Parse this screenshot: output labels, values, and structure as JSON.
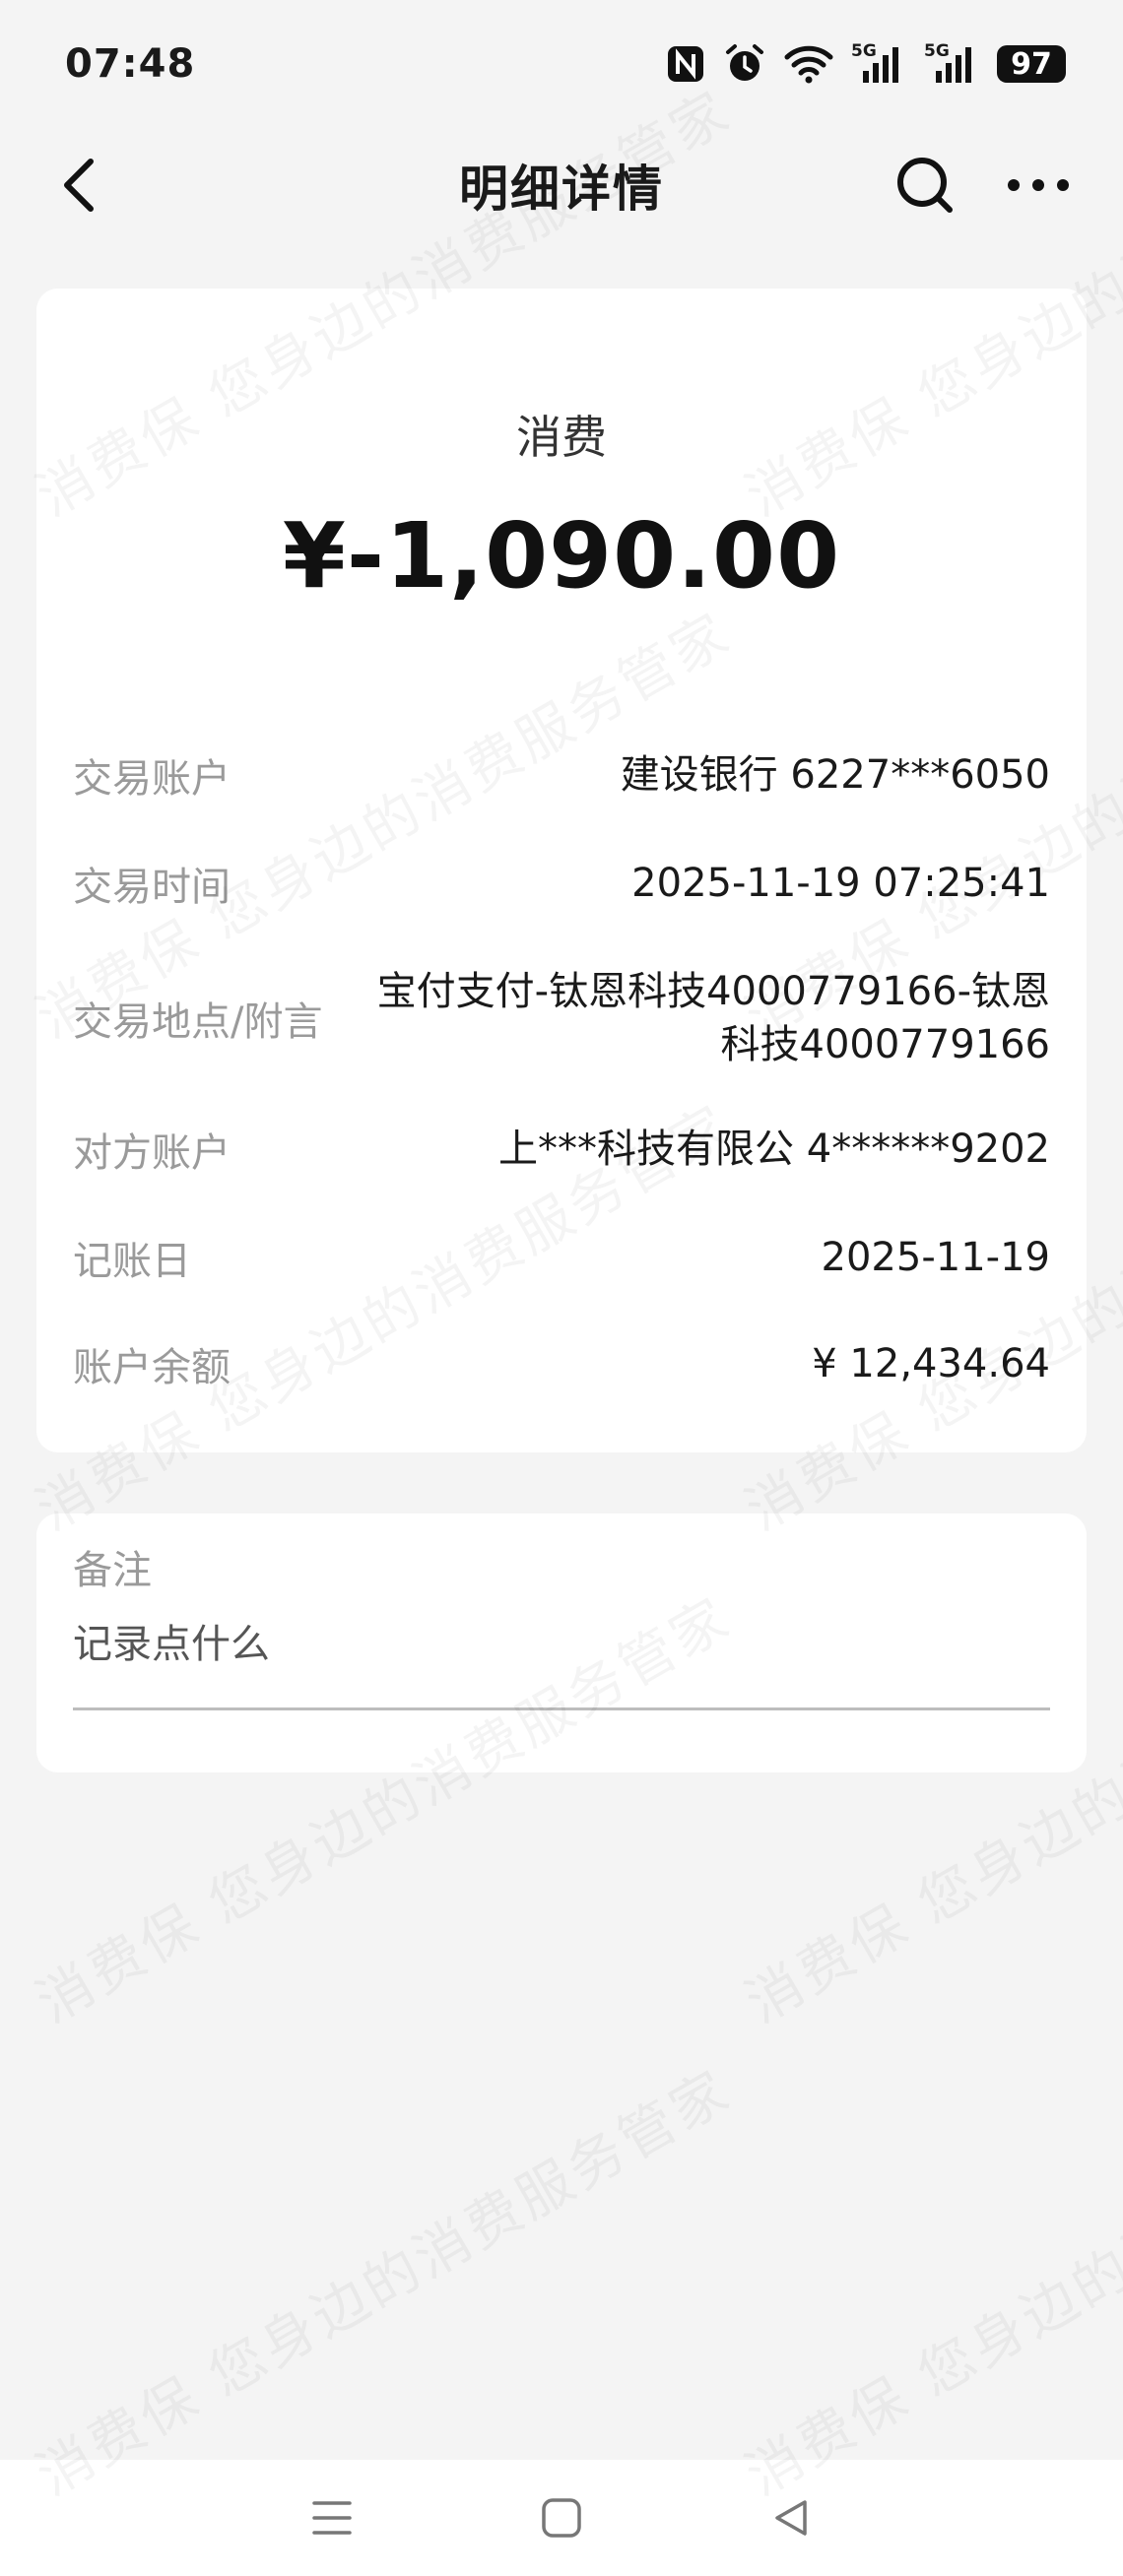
{
  "status_bar": {
    "time": "07:48",
    "battery": "97",
    "signal1_label": "5G",
    "signal2_label": "5G",
    "icons": [
      "nfc-icon",
      "alarm-icon",
      "wifi-icon",
      "signal-5g-icon",
      "signal-5g-icon",
      "battery-icon"
    ]
  },
  "nav": {
    "title": "明细详情",
    "back_icon": "chevron-left-icon",
    "search_icon": "search-icon",
    "more_icon": "more-horizontal-icon"
  },
  "transaction": {
    "type": "消费",
    "amount": "¥-1,090.00"
  },
  "details": [
    {
      "label": "交易账户",
      "value": "建设银行 6227***6050"
    },
    {
      "label": "交易时间",
      "value": "2025-11-19 07:25:41"
    },
    {
      "label": "交易地点/附言",
      "value": "宝付支付-钛恩科技4000779166-钛恩科技4000779166"
    },
    {
      "label": "对方账户",
      "value": "上***科技有限公 4******9202"
    },
    {
      "label": "记账日",
      "value": "2025-11-19"
    },
    {
      "label": "账户余额",
      "value": "¥ 12,434.64"
    }
  ],
  "note": {
    "label": "备注",
    "placeholder": "记录点什么"
  },
  "watermark": "消费保 您身边的消费服务管家",
  "system_nav": [
    "menu-icon",
    "home-icon",
    "back-triangle-icon"
  ]
}
